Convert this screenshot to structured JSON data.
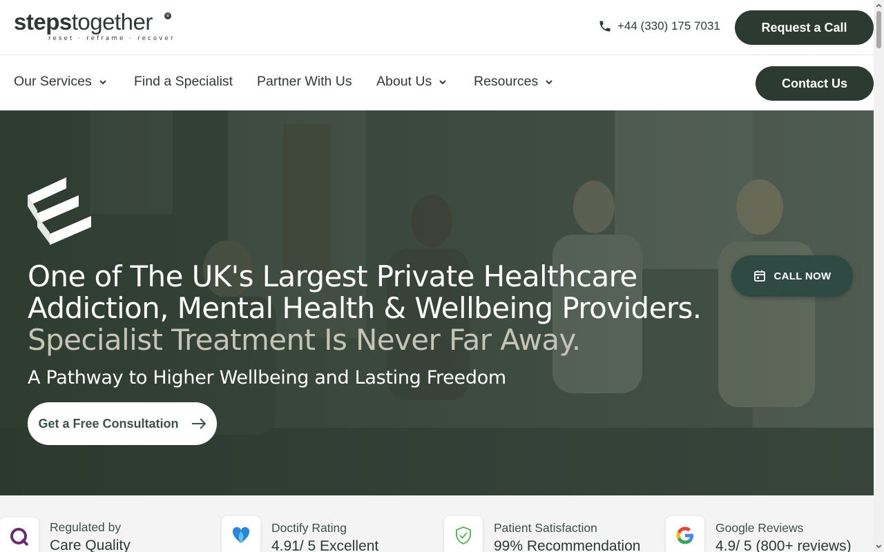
{
  "header": {
    "logo": {
      "bold": "steps",
      "light": "together",
      "tagline": "reset · reframe · recover"
    },
    "phone": "+44 (330) 175 7031",
    "request_button": "Request a Call"
  },
  "nav": {
    "items": [
      {
        "label": "Our Services",
        "has_dropdown": true
      },
      {
        "label": "Find a Specialist",
        "has_dropdown": false
      },
      {
        "label": "Partner With Us",
        "has_dropdown": false
      },
      {
        "label": "About Us",
        "has_dropdown": true
      },
      {
        "label": "Resources",
        "has_dropdown": true
      }
    ],
    "contact_button": "Contact Us"
  },
  "hero": {
    "title_line1": "One of The UK's Largest Private Healthcare",
    "title_line2": "Addiction, Mental Health & Wellbeing Providers.",
    "title_line3": "Specialist Treatment Is Never Far Away.",
    "subtitle": "A Pathway to Higher Wellbeing and Lasting Freedom",
    "cta_button": "Get a Free Consultation",
    "call_now_button": "CALL NOW"
  },
  "ratings": [
    {
      "label": "Regulated by",
      "value": "Care Quality",
      "icon": "cqc-icon"
    },
    {
      "label": "Doctify Rating",
      "value": "4.91/ 5 Excellent",
      "icon": "doctify-icon"
    },
    {
      "label": "Patient Satisfaction",
      "value": "99% Recommendation",
      "icon": "shield-check-icon"
    },
    {
      "label": "Google Reviews",
      "value": "4.9/ 5 (800+ reviews)",
      "icon": "google-icon"
    }
  ],
  "colors": {
    "brand_dark": "#2b3b32",
    "call_now": "#2e4a43",
    "hero_muted_text": "#c6c4b4"
  }
}
